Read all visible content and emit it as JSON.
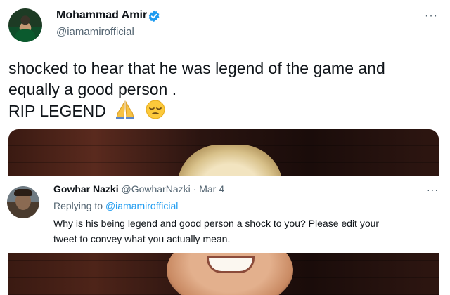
{
  "tweet": {
    "author_name": "Mohammad Amir",
    "handle": "@iamamirofficial",
    "more": "···",
    "lines": [
      "shocked to hear that  he was legend of the game and",
      "equally a good person .",
      "RIP LEGEND"
    ],
    "emojis": [
      "folded-hands",
      "pensive-face"
    ]
  },
  "reply": {
    "author_name": "Gowhar Nazki",
    "handle": "@GowharNazki",
    "separator": " · ",
    "date": "Mar 4",
    "more": "···",
    "replying_prefix": "Replying to ",
    "replying_to": "@iamamirofficial",
    "lines": [
      "Why is his being legend and good person a shock to you? Please edit your",
      "tweet to convey what you actually mean."
    ]
  },
  "colors": {
    "link": "#1d9bf0",
    "secondary_text": "#536471",
    "verified": "#1d9bf0"
  }
}
